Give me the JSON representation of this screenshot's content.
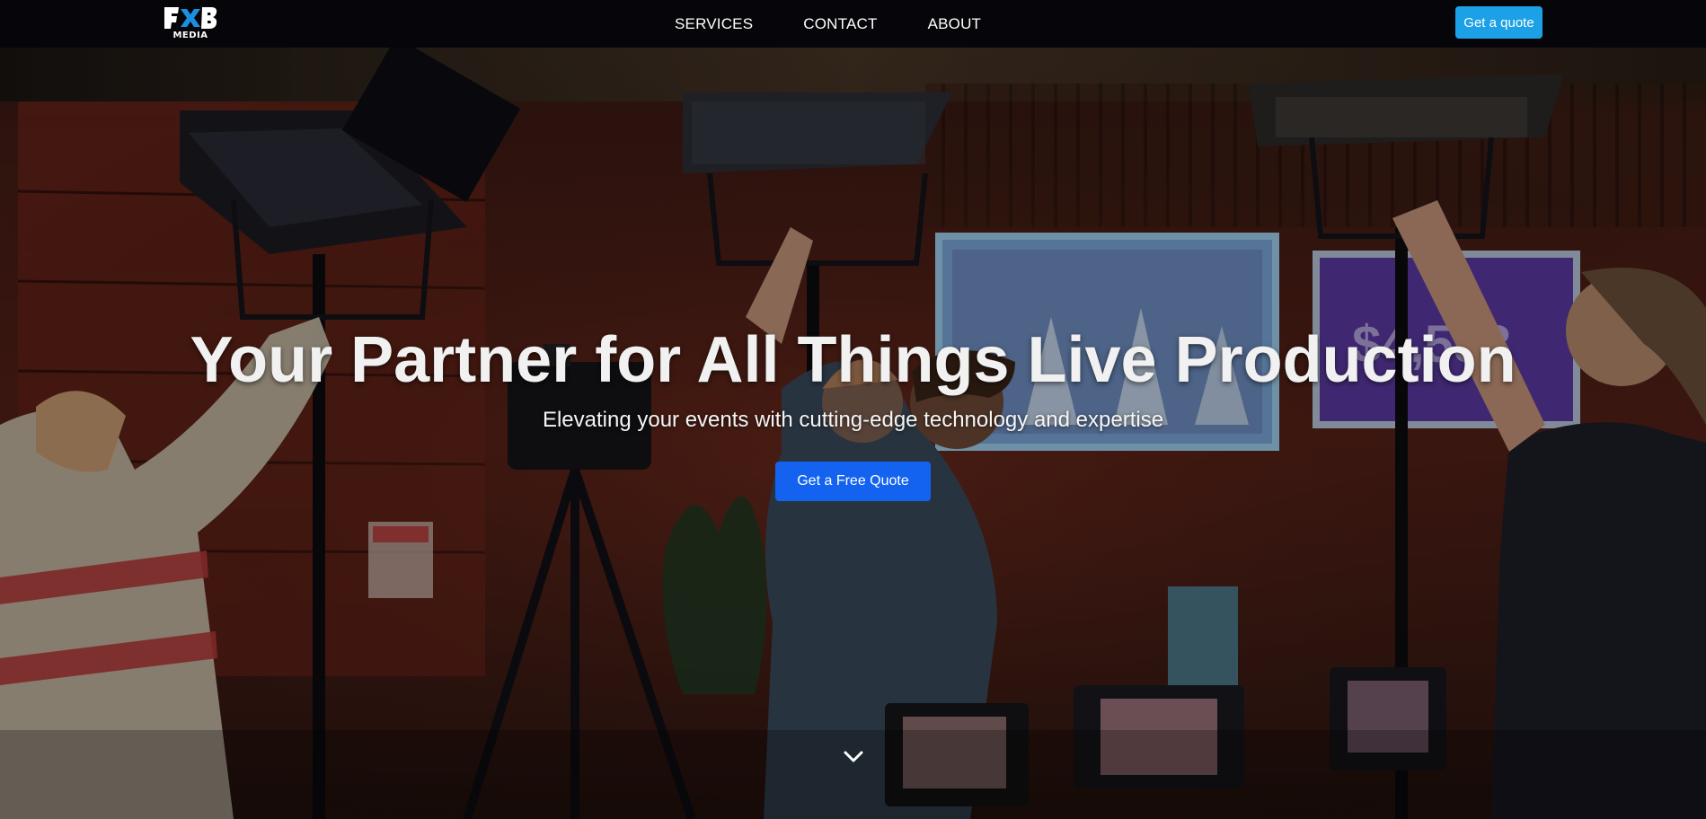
{
  "brand": {
    "logo_mark": "FXB",
    "logo_sub": "MEDIA",
    "logo_icon": "fxb-media-logo"
  },
  "nav": {
    "links": [
      {
        "label": "SERVICES"
      },
      {
        "label": "CONTACT"
      },
      {
        "label": "ABOUT"
      }
    ],
    "quote_button": "Get a quote"
  },
  "hero": {
    "title": "Your Partner for All Things Live Production",
    "subtitle": "Elevating your events with cutting-edge technology and expertise",
    "cta_label": "Get a Free Quote",
    "scroll_icon": "chevron-down-icon"
  },
  "colors": {
    "nav_bg": "#06060a",
    "quote_button_bg": "#1da1e6",
    "cta_bg": "#1463f0",
    "logo_blue": "#1a8fe0"
  }
}
